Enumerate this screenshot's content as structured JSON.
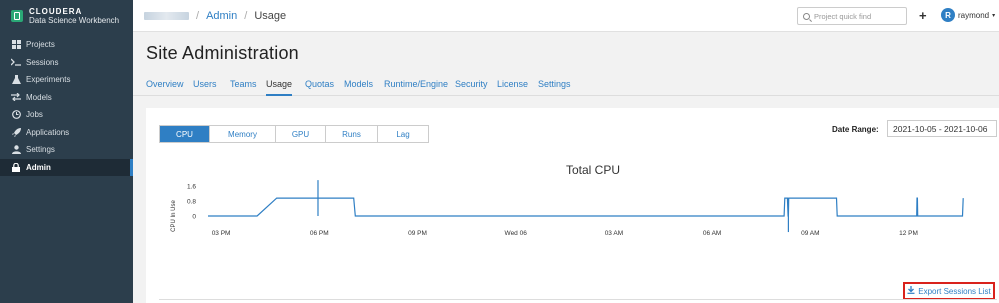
{
  "brand": {
    "name": "CLOUDERA",
    "subtitle": "Data Science Workbench"
  },
  "sidebar": {
    "items": [
      {
        "label": "Projects",
        "icon": "projects-icon",
        "active": false
      },
      {
        "label": "Sessions",
        "icon": "terminal-icon",
        "active": false
      },
      {
        "label": "Experiments",
        "icon": "flask-icon",
        "active": false
      },
      {
        "label": "Models",
        "icon": "exchange-icon",
        "active": false
      },
      {
        "label": "Jobs",
        "icon": "clock-icon",
        "active": false
      },
      {
        "label": "Applications",
        "icon": "rocket-icon",
        "active": false
      },
      {
        "label": "Settings",
        "icon": "user-icon",
        "active": false
      },
      {
        "label": "Admin",
        "icon": "lock-icon",
        "active": true
      }
    ]
  },
  "topbar": {
    "breadcrumb": {
      "admin": "Admin",
      "current": "Usage",
      "separator": "/"
    },
    "search_placeholder": "Project quick find",
    "add_label": "+",
    "user": {
      "initial": "R",
      "name": "raymond",
      "caret": "▾"
    }
  },
  "page": {
    "title": "Site Administration",
    "tabs": [
      "Overview",
      "Users",
      "Teams",
      "Usage",
      "Quotas",
      "Models",
      "Runtime/Engine",
      "Security",
      "License",
      "Settings"
    ],
    "active_tab": "Usage"
  },
  "usage": {
    "metrics": [
      "CPU",
      "Memory",
      "GPU",
      "Runs",
      "Lag"
    ],
    "active_metric": "CPU",
    "date_range_label": "Date Range:",
    "date_range_value": "2021-10-05 - 2021-10-06",
    "export_label": "Export Sessions List"
  },
  "chart_data": {
    "type": "line",
    "title": "Total CPU",
    "ylabel": "CPU In Use",
    "xlabel": "",
    "ylim": [
      0,
      1.8
    ],
    "yticks": [
      "1.6",
      "0.8",
      "0"
    ],
    "x_tick_labels": [
      "03 PM",
      "06 PM",
      "09 PM",
      "Wed 06",
      "03 AM",
      "06 AM",
      "09 AM",
      "12 PM"
    ],
    "x_hours": [
      0,
      1.5,
      2.1,
      2.12,
      3.35,
      3.37,
      4.45,
      4.5,
      17.6,
      17.62,
      17.7,
      17.72,
      17.73,
      17.74,
      17.76,
      17.78,
      19.2,
      19.22,
      21.65,
      21.66,
      21.67,
      21.68,
      23.05,
      23.07
    ],
    "y_values": [
      0,
      0,
      0.95,
      0.95,
      0.95,
      0.95,
      0.95,
      0,
      0,
      0.95,
      0.95,
      0,
      0,
      0.95,
      0.95,
      0.95,
      0.95,
      0,
      0,
      0.95,
      0.95,
      0,
      0,
      0.95
    ],
    "spikes": [
      {
        "x_hours": 3.36,
        "y": 1.9
      },
      {
        "x_hours": 17.73,
        "y": -0.85
      },
      {
        "x_hours": 21.67,
        "y": 0.95
      }
    ],
    "series": [
      {
        "values": [
          0,
          0.95,
          1.9,
          0.95,
          0,
          0.95,
          0,
          0.95,
          0
        ]
      }
    ],
    "grid": false,
    "line_color": "#2f7fc4"
  },
  "colors": {
    "accent": "#2f7fc4",
    "sidebar": "#2c3e4c",
    "export_border": "#d9221c"
  }
}
